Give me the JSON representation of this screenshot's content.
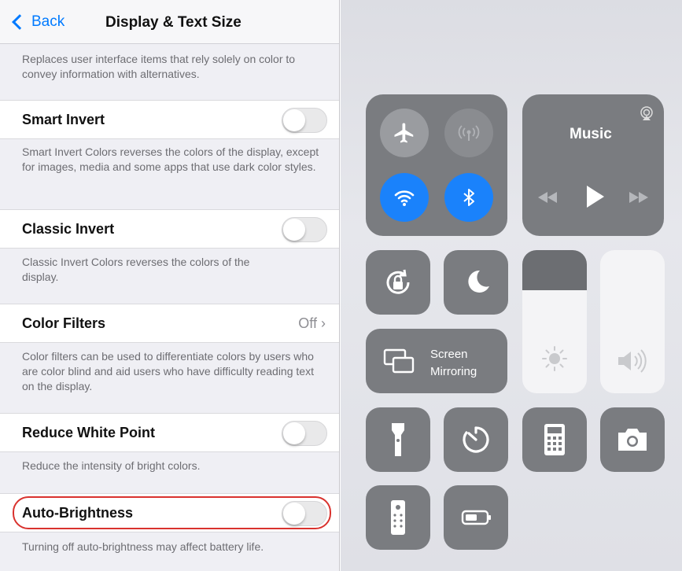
{
  "settings": {
    "nav": {
      "back_label": "Back",
      "title": "Display & Text Size"
    },
    "top_description": "Replaces user interface items that rely solely on color to convey information with alternatives.",
    "rows": [
      {
        "label": "Smart Invert",
        "control": "toggle",
        "on": false,
        "description": "Smart Invert Colors reverses the colors of the display, except for images, media and some apps that use dark color styles."
      },
      {
        "label": "Classic Invert",
        "control": "toggle",
        "on": false,
        "description": "Classic Invert Colors reverses the colors of the display."
      },
      {
        "label": "Color Filters",
        "control": "detail",
        "value": "Off",
        "description": "Color filters can be used to differentiate colors by users who are color blind and aid users who have difficulty reading text on the display."
      },
      {
        "label": "Reduce White Point",
        "control": "toggle",
        "on": false,
        "description": "Reduce the intensity of bright colors."
      },
      {
        "label": "Auto-Brightness",
        "control": "toggle",
        "on": false,
        "highlighted": true,
        "description": "Turning off auto-brightness may affect battery life."
      }
    ]
  },
  "control_center": {
    "connectivity": {
      "airplane": {
        "icon": "airplane-icon",
        "active": false
      },
      "cellular": {
        "icon": "cellular-icon",
        "active": false
      },
      "wifi": {
        "icon": "wifi-icon",
        "active": true
      },
      "bluetooth": {
        "icon": "bluetooth-icon",
        "active": true
      },
      "active_color": "#1a82fb"
    },
    "music": {
      "title": "Music"
    },
    "screen_mirroring": {
      "label_line1": "Screen",
      "label_line2": "Mirroring"
    },
    "brightness_level": 0.72,
    "volume_level": 1.0,
    "buttons": [
      "orientation-lock-icon",
      "do-not-disturb-icon",
      "flashlight-icon",
      "timer-icon",
      "calculator-icon",
      "camera-icon",
      "remote-icon",
      "low-power-icon"
    ]
  }
}
